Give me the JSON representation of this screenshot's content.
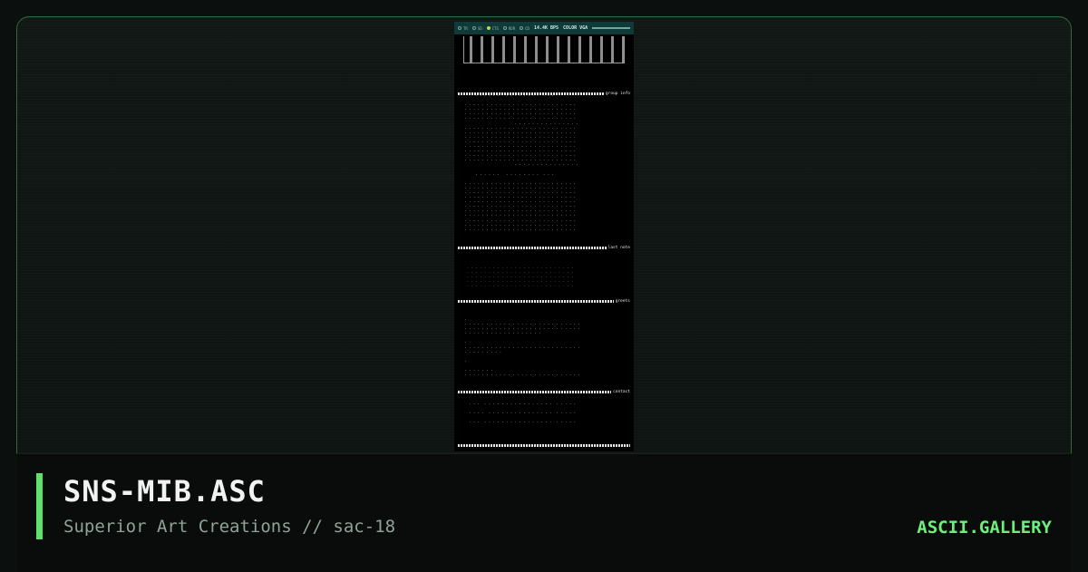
{
  "art": {
    "status_bar": {
      "indicators": [
        {
          "label": "TR",
          "on": false
        },
        {
          "label": "SD",
          "on": false
        },
        {
          "label": "CTS",
          "on": true
        },
        {
          "label": "RDR",
          "on": false
        },
        {
          "label": "CD",
          "on": false
        }
      ],
      "speed": "14.4K BPS",
      "mode": "COLOR VGA"
    },
    "bars": [
      {
        "label": "group info"
      },
      {
        "label": "last note"
      },
      {
        "label": "greets"
      },
      {
        "label": "contact"
      }
    ]
  },
  "footer": {
    "filename": "SNS-MIB.ASC",
    "subtitle": "Superior Art Creations // sac-18",
    "brand": "ASCII.GALLERY"
  },
  "colors": {
    "accent": "#5ee06a",
    "brand": "#6df07a",
    "background": "#0b100e"
  }
}
